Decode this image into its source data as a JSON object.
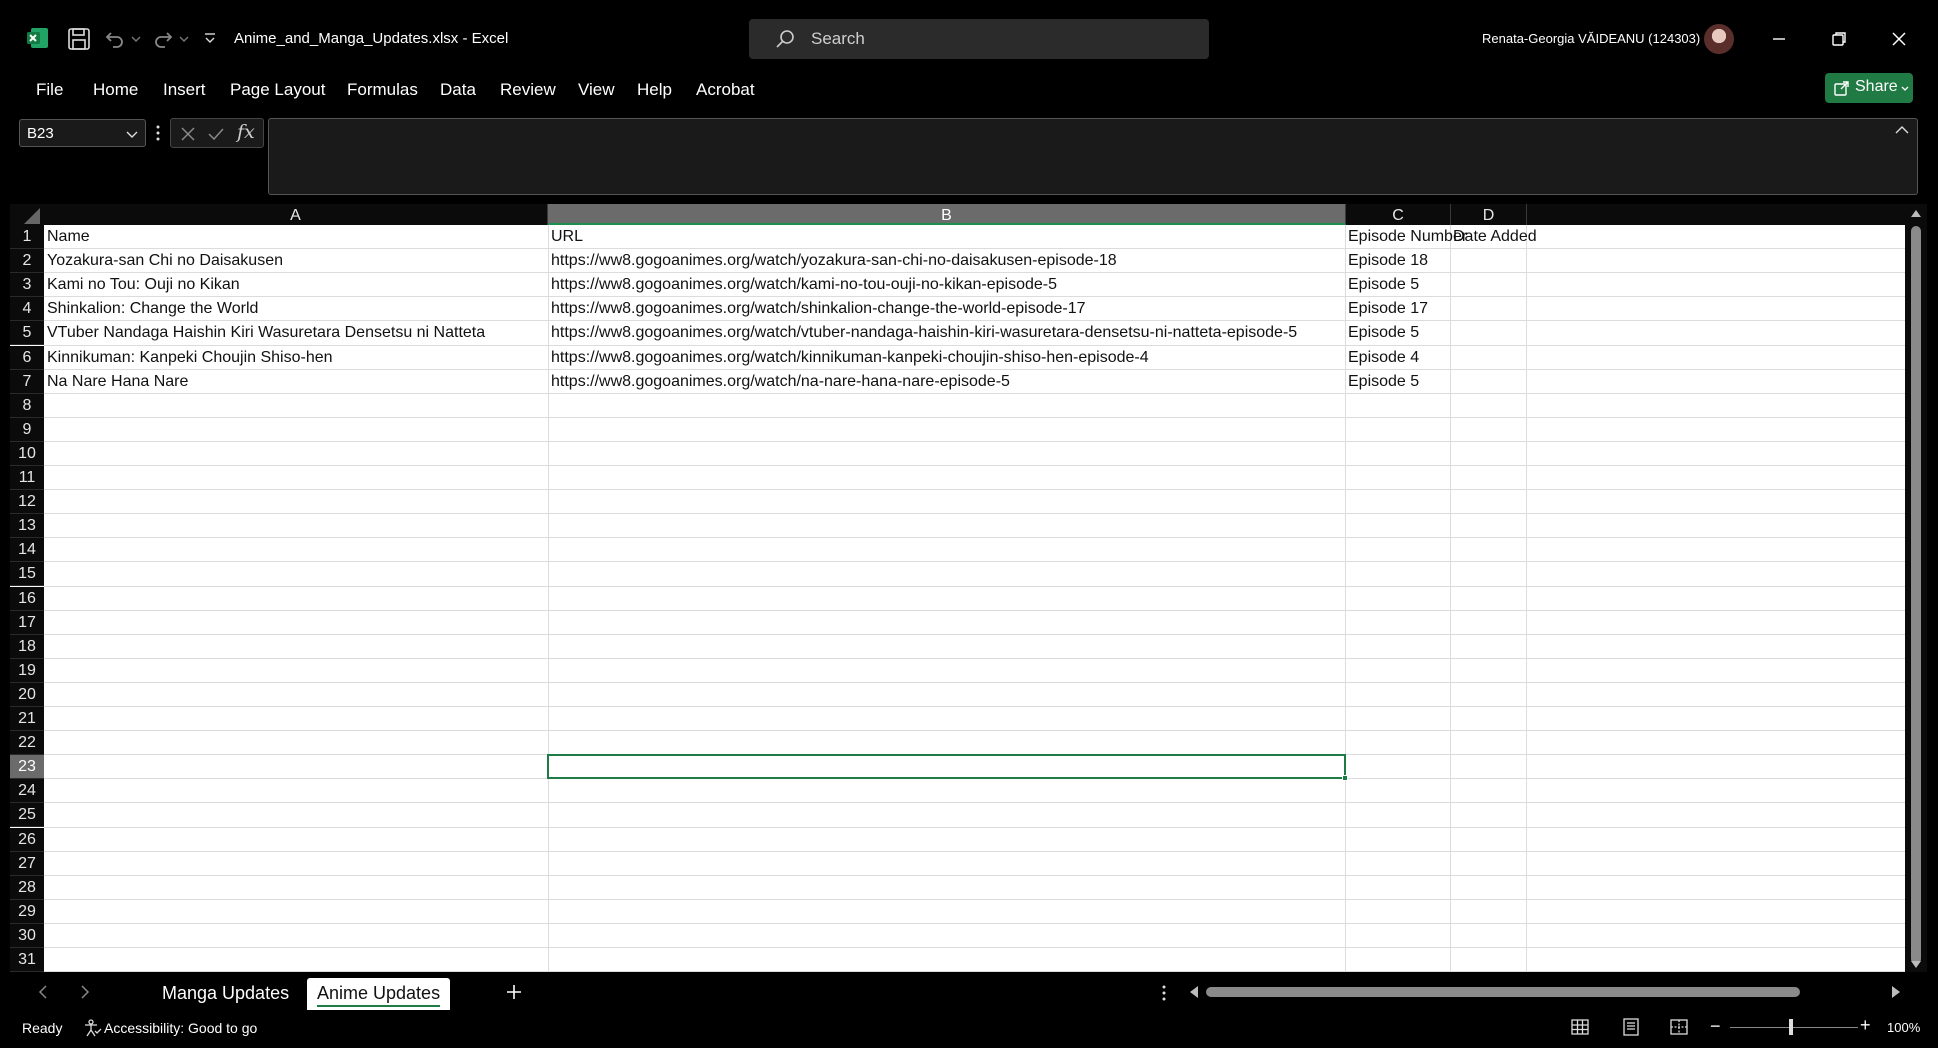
{
  "titlebar": {
    "doc_title": "Anime_and_Manga_Updates.xlsx  -  Excel",
    "search_placeholder": "Search",
    "user_name": "Renata-Georgia VĂIDEANU (124303)"
  },
  "menu": {
    "items": [
      "File",
      "Home",
      "Insert",
      "Page Layout",
      "Formulas",
      "Data",
      "Review",
      "View",
      "Help",
      "Acrobat"
    ],
    "share_label": "Share"
  },
  "formula_bar": {
    "name_box": "B23",
    "fx_label": "fx",
    "formula": ""
  },
  "sheet": {
    "columns": [
      "A",
      "B",
      "C",
      "D"
    ],
    "selected_column": "B",
    "selected_row": "23",
    "row_numbers": [
      "1",
      "2",
      "3",
      "4",
      "5",
      "6",
      "7",
      "8",
      "9",
      "10",
      "11",
      "12",
      "13",
      "14",
      "15",
      "16",
      "17",
      "18",
      "19",
      "20",
      "21",
      "22",
      "23",
      "24",
      "25",
      "26",
      "27",
      "28",
      "29",
      "30",
      "31"
    ],
    "header_row": [
      "Name",
      "URL",
      "Episode Number",
      "Date Added"
    ],
    "rows": [
      [
        "Yozakura-san Chi no Daisakusen",
        "https://ww8.gogoanimes.org/watch/yozakura-san-chi-no-daisakusen-episode-18",
        "Episode 18",
        ""
      ],
      [
        "Kami no Tou: Ouji no Kikan",
        "https://ww8.gogoanimes.org/watch/kami-no-tou-ouji-no-kikan-episode-5",
        "Episode 5",
        ""
      ],
      [
        "Shinkalion: Change the World",
        "https://ww8.gogoanimes.org/watch/shinkalion-change-the-world-episode-17",
        "Episode 17",
        ""
      ],
      [
        "VTuber Nandaga Haishin Kiri Wasuretara Densetsu ni Natteta",
        "https://ww8.gogoanimes.org/watch/vtuber-nandaga-haishin-kiri-wasuretara-densetsu-ni-natteta-episode-5",
        "Episode 5",
        ""
      ],
      [
        "Kinnikuman: Kanpeki Choujin Shiso-hen",
        "https://ww8.gogoanimes.org/watch/kinnikuman-kanpeki-choujin-shiso-hen-episode-4",
        "Episode 4",
        ""
      ],
      [
        "Na Nare Hana Nare",
        "https://ww8.gogoanimes.org/watch/na-nare-hana-nare-episode-5",
        "Episode 5",
        ""
      ]
    ]
  },
  "tabs": {
    "sheets": [
      "Manga Updates",
      "Anime Updates"
    ],
    "active": "Anime Updates"
  },
  "status": {
    "ready": "Ready",
    "accessibility": "Accessibility: Good to go",
    "zoom": "100%",
    "zoom_minus": "−",
    "zoom_plus": "+"
  },
  "colors": {
    "accent_green": "#1e7b45",
    "share_green": "#1f7a43"
  }
}
